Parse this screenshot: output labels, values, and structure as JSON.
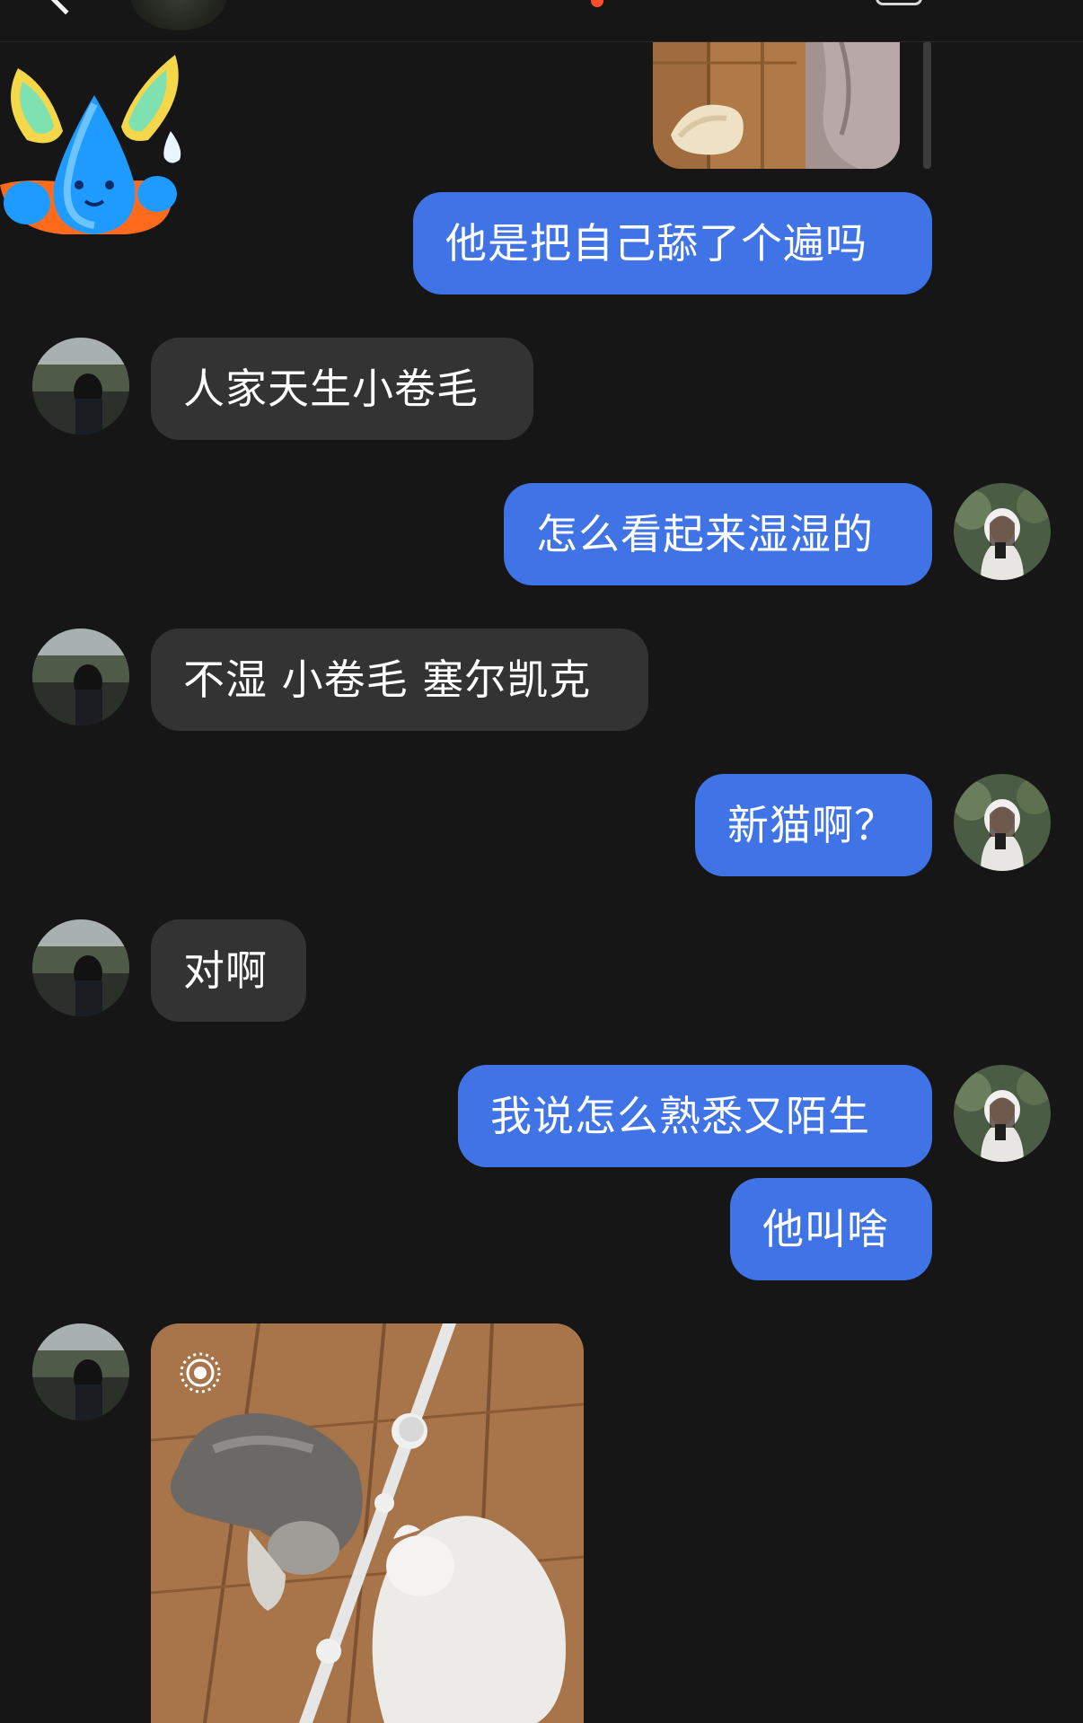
{
  "header": {
    "title": "",
    "unread_dot": true
  },
  "messages": [
    {
      "side": "me",
      "kind": "image"
    },
    {
      "side": "me",
      "kind": "text",
      "text": "他是把自己舔了个遍吗"
    },
    {
      "side": "them",
      "kind": "text",
      "text": "人家天生小卷毛"
    },
    {
      "side": "me",
      "kind": "text",
      "text": "怎么看起来湿湿的"
    },
    {
      "side": "them",
      "kind": "text",
      "text": "不湿 小卷毛 塞尔凯克"
    },
    {
      "side": "me",
      "kind": "text",
      "text": "新猫啊？"
    },
    {
      "side": "them",
      "kind": "text",
      "text": "对啊"
    },
    {
      "side": "me",
      "kind": "text",
      "text": "我说怎么熟悉又陌生"
    },
    {
      "side": "me",
      "kind": "text",
      "text": "他叫啥"
    },
    {
      "side": "them",
      "kind": "live-photo"
    }
  ],
  "colors": {
    "background": "#161616",
    "my_bubble": "#3f73e6",
    "their_bubble": "#333333",
    "text": "#ffffff",
    "unread_dot": "#ff4d2e"
  },
  "icons": {
    "back": "back-chevron-icon",
    "more": "more-options-icon",
    "live_photo": "live-photo-icon"
  }
}
